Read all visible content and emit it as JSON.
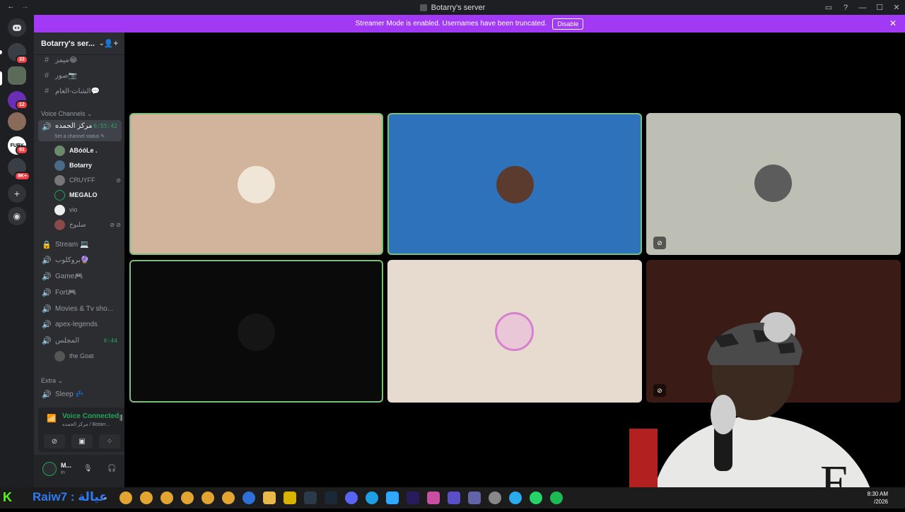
{
  "window": {
    "title": "Botarry's server",
    "back": "←",
    "forward": "→",
    "controls": [
      "▭",
      "?",
      "—",
      "☐",
      "✕"
    ]
  },
  "banner": {
    "text": "Streamer Mode is enabled. Usernames have been truncated.",
    "button": "Disable",
    "close": "✕"
  },
  "guilds": {
    "badges": [
      "33",
      "12",
      "91",
      "9K+"
    ]
  },
  "sidebar": {
    "server_name": "Botarry's ser...",
    "chevron": "⌄",
    "invite_icon": "👤+",
    "text_channels": [
      {
        "icon": "#",
        "label": "ميمز😂"
      },
      {
        "icon": "#",
        "label": "صور📷"
      },
      {
        "icon": "#",
        "label": "الشات-العام💬"
      }
    ],
    "voice_section": "Voice Channels",
    "active_channel": {
      "label": "مركز الحمده",
      "timer": "6:55:42",
      "status": "Set a channel status ✎"
    },
    "voice_users": [
      {
        "name": "ABóóLe .",
        "bright": true
      },
      {
        "name": "Botarry",
        "bright": true
      },
      {
        "name": "CRUYFF",
        "bright": false,
        "mute": "⊘"
      },
      {
        "name": "MEGALO",
        "bright": true
      },
      {
        "name": "vio",
        "bright": false
      },
      {
        "name": "صلبوخ",
        "bright": false,
        "mute": "⊘ ⊘"
      }
    ],
    "voice_channels": [
      {
        "icon": "🔒",
        "label": "Stream 💻"
      },
      {
        "icon": "🔊",
        "label": "بروكلوب🔮"
      },
      {
        "icon": "🔊",
        "label": "Game🎮"
      },
      {
        "icon": "🔊",
        "label": "Fort🎮"
      },
      {
        "icon": "🔊",
        "label": "Movies & Tv sho..."
      },
      {
        "icon": "🔊",
        "label": "apex-legends"
      }
    ],
    "majlis": {
      "label": "المجلس",
      "timer": "6:44",
      "user": "the Goat"
    },
    "extra_section": "Extra",
    "sleep": {
      "label": "Sleep 💤"
    }
  },
  "voice_panel": {
    "title": "Voice Connected",
    "subtitle": "مركز الحمده / Botarr...",
    "user_initial": "M...",
    "user_status": "In"
  },
  "tiles": [
    {
      "color": "#d2b39b",
      "border": "#7bbf7b",
      "avatar": "#f0e6d8",
      "muted": false
    },
    {
      "color": "#2f72bc",
      "border": "#7bbf7b",
      "avatar": "#5a3b2e",
      "muted": false
    },
    {
      "color": "#bebfb4",
      "border": "none",
      "avatar": "#5c5c5c",
      "muted": true
    },
    {
      "color": "#0a0a0a",
      "border": "#7bbf7b",
      "avatar": "#151515",
      "muted": false
    },
    {
      "color": "#e6dbce",
      "border": "none",
      "avatar": "#e9c7d6",
      "muted": false
    },
    {
      "color": "#3a1b16",
      "border": "none",
      "avatar": "#c9c9c9",
      "muted": true
    }
  ],
  "taskbar": {
    "logo": "K",
    "name": "Raiw7 : عيالة",
    "clock_time": "8:30 AM",
    "clock_date": "/2026"
  }
}
